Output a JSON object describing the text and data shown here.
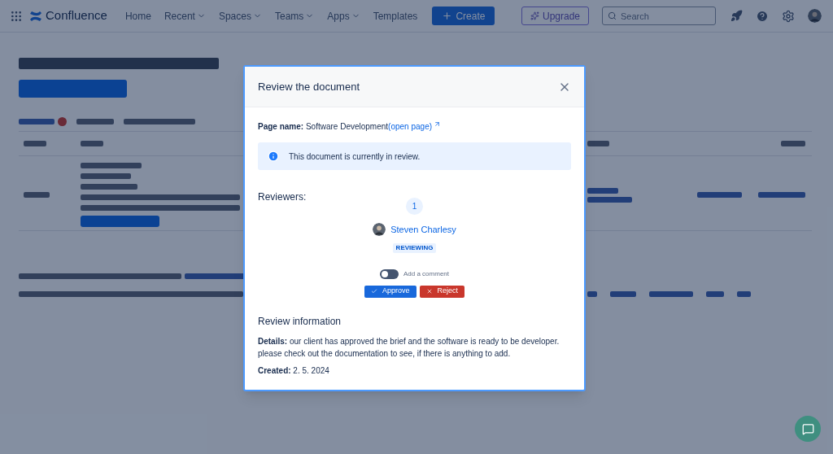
{
  "topbar": {
    "product": "Confluence",
    "nav": [
      {
        "label": "Home",
        "dropdown": false
      },
      {
        "label": "Recent",
        "dropdown": true
      },
      {
        "label": "Spaces",
        "dropdown": true
      },
      {
        "label": "Teams",
        "dropdown": true
      },
      {
        "label": "Apps",
        "dropdown": true
      },
      {
        "label": "Templates",
        "dropdown": false
      }
    ],
    "create": "Create",
    "upgrade": "Upgrade",
    "search": {
      "placeholder": "Search"
    }
  },
  "modal": {
    "title": "Review the document",
    "page_name_label": "Page name:",
    "page_name": "Software Development",
    "open_page": "(open page)",
    "notice": "This document is currently in review.",
    "reviewers_heading": "Reviewers:",
    "reviewer_count": "1",
    "reviewers": [
      {
        "name": "Steven Charlesy",
        "status": "REVIEWING"
      }
    ],
    "comment_toggle": {
      "label": "Add a comment",
      "on": false
    },
    "approve": "Approve",
    "reject": "Reject",
    "info_heading": "Review information",
    "details_label": "Details:",
    "details": "our client has approved the brief and the software is ready to be developer. please check out the documentation to see, if there is anything to add.",
    "created_label": "Created:",
    "created": "2. 5. 2024"
  }
}
